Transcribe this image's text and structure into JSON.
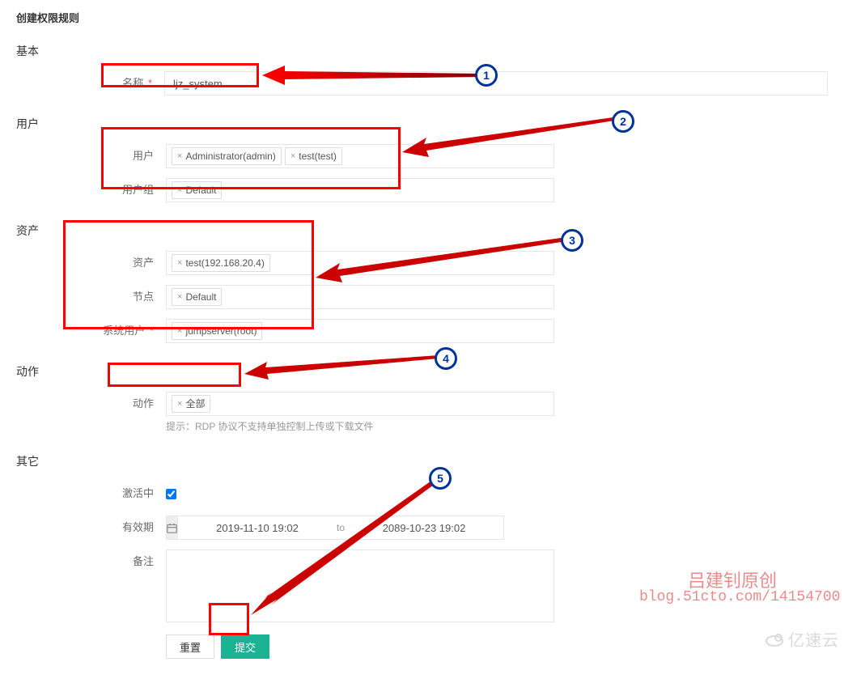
{
  "pageTitle": "创建权限规则",
  "sections": {
    "basic": "基本",
    "user": "用户",
    "asset": "资产",
    "action": "动作",
    "other": "其它"
  },
  "labels": {
    "name": "名称",
    "user": "用户",
    "userGroup": "用户组",
    "asset": "资产",
    "node": "节点",
    "sysUser": "系统用户",
    "action": "动作",
    "active": "激活中",
    "validity": "有效期",
    "remark": "备注"
  },
  "required": "*",
  "values": {
    "name": "ljz_system",
    "userTags": [
      "Administrator(admin)",
      "test(test)"
    ],
    "userGroupTags": [
      "Default"
    ],
    "assetTags": [
      "test(192.168.20.4)"
    ],
    "nodeTags": [
      "Default"
    ],
    "sysUserTags": [
      "jumpserver(root)"
    ],
    "actionTags": [
      "全部"
    ],
    "activeChecked": true,
    "dateFrom": "2019-11-10 19:02",
    "dateTo": "2089-10-23 19:02",
    "dateSep": "to",
    "remark": ""
  },
  "hints": {
    "action": "提示：RDP 协议不支持单独控制上传或下载文件"
  },
  "buttons": {
    "reset": "重置",
    "submit": "提交"
  },
  "tagClose": "×",
  "watermark": {
    "line1": "吕建钊原创",
    "line2": "blog.51cto.com/14154700"
  },
  "logo": "亿速云",
  "badges": [
    "1",
    "2",
    "3",
    "4",
    "5"
  ]
}
